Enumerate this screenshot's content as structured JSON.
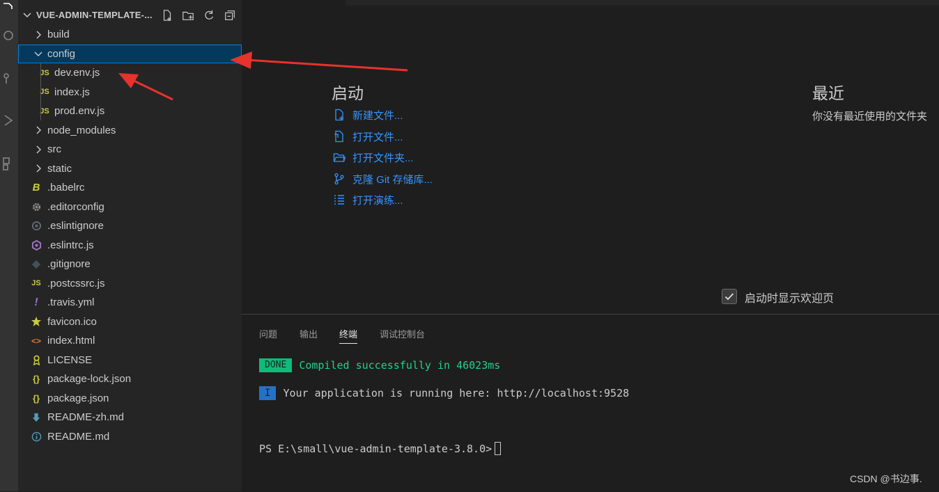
{
  "explorer": {
    "title": "VUE-ADMIN-TEMPLATE-...",
    "items": [
      {
        "label": "build",
        "kind": "folder",
        "expanded": false,
        "depth": 0,
        "icon": "chevron-right-icon"
      },
      {
        "label": "config",
        "kind": "folder",
        "expanded": true,
        "depth": 0,
        "icon": "chevron-down-icon",
        "selected": true
      },
      {
        "label": "dev.env.js",
        "kind": "file",
        "depth": 1,
        "icon_text": "JS"
      },
      {
        "label": "index.js",
        "kind": "file",
        "depth": 1,
        "icon_text": "JS"
      },
      {
        "label": "prod.env.js",
        "kind": "file",
        "depth": 1,
        "icon_text": "JS"
      },
      {
        "label": "node_modules",
        "kind": "folder",
        "expanded": false,
        "depth": 0
      },
      {
        "label": "src",
        "kind": "folder",
        "expanded": false,
        "depth": 0
      },
      {
        "label": "static",
        "kind": "folder",
        "expanded": false,
        "depth": 0
      },
      {
        "label": ".babelrc",
        "kind": "file",
        "depth": 0,
        "icon_text": "B"
      },
      {
        "label": ".editorconfig",
        "kind": "file",
        "depth": 0,
        "icon": "gear-icon"
      },
      {
        "label": ".eslintignore",
        "kind": "file",
        "depth": 0,
        "icon": "eslint-ignore-icon"
      },
      {
        "label": ".eslintrc.js",
        "kind": "file",
        "depth": 0,
        "icon": "eslint-icon"
      },
      {
        "label": ".gitignore",
        "kind": "file",
        "depth": 0,
        "icon": "git-icon"
      },
      {
        "label": ".postcssrc.js",
        "kind": "file",
        "depth": 0,
        "icon_text": "JS"
      },
      {
        "label": ".travis.yml",
        "kind": "file",
        "depth": 0,
        "icon_text": "!"
      },
      {
        "label": "favicon.ico",
        "kind": "file",
        "depth": 0,
        "icon": "star-icon"
      },
      {
        "label": "index.html",
        "kind": "file",
        "depth": 0,
        "icon_text": "<>"
      },
      {
        "label": "LICENSE",
        "kind": "file",
        "depth": 0,
        "icon": "license-icon"
      },
      {
        "label": "package-lock.json",
        "kind": "file",
        "depth": 0,
        "icon_text": "{}"
      },
      {
        "label": "package.json",
        "kind": "file",
        "depth": 0,
        "icon_text": "{}"
      },
      {
        "label": "README-zh.md",
        "kind": "file",
        "depth": 0,
        "icon": "download-arrow-icon"
      },
      {
        "label": "README.md",
        "kind": "file",
        "depth": 0,
        "icon": "info-icon"
      }
    ]
  },
  "welcome": {
    "start_title": "启动",
    "start_items": [
      {
        "label": "新建文件...",
        "icon": "new-file-icon"
      },
      {
        "label": "打开文件...",
        "icon": "open-file-icon"
      },
      {
        "label": "打开文件夹...",
        "icon": "open-folder-icon"
      },
      {
        "label": "克隆 Git 存储库...",
        "icon": "git-clone-icon"
      },
      {
        "label": "打开演练...",
        "icon": "walkthrough-icon"
      }
    ],
    "recent_title": "最近",
    "recent_text": "你没有最近使用的文件夹",
    "show_on_startup_label": "启动时显示欢迎页"
  },
  "panel": {
    "tabs": [
      {
        "label": "问题",
        "active": false
      },
      {
        "label": "输出",
        "active": false
      },
      {
        "label": "终端",
        "active": true
      },
      {
        "label": "调试控制台",
        "active": false
      }
    ],
    "terminal": {
      "done_badge": "DONE",
      "compiled_text": "Compiled successfully in 46023ms",
      "info_badge": "I",
      "running_text": "Your application is running here: http://localhost:9528",
      "prompt": "PS E:\\small\\vue-admin-template-3.8.0>"
    }
  },
  "watermark": "CSDN @书边事.",
  "colors": {
    "accent_link": "#3794ff",
    "selection_bg": "#04395e",
    "js_yellow": "#cbcb41",
    "done_green": "#0dbc79",
    "info_blue": "#2472c8",
    "annotation_red": "#e8322c"
  }
}
